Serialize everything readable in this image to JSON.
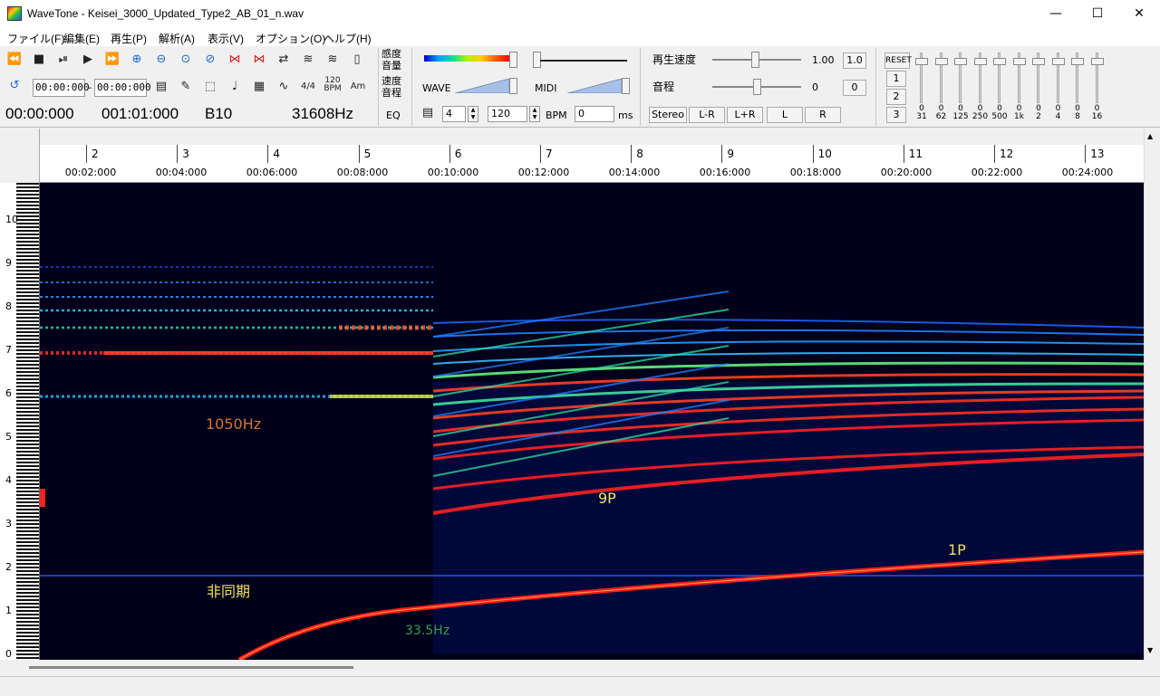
{
  "window": {
    "title": "WaveTone - Keisei_3000_Updated_Type2_AB_01_n.wav",
    "controls": {
      "minimize": "—",
      "maximize": "☐",
      "close": "✕"
    }
  },
  "menu": [
    "ファイル(F)",
    "編集(E)",
    "再生(P)",
    "解析(A)",
    "表示(V)",
    "オプション(O)",
    "ヘルプ(H)"
  ],
  "toolbar": {
    "transport_icons": [
      "rewind-icon",
      "stop-icon",
      "pause-play-icon",
      "play-icon",
      "fast-forward-icon",
      "zoom-in-icon",
      "zoom-out-icon",
      "zoom-fit-icon",
      "zoom-reset-icon",
      "expand-h-icon",
      "shrink-h-icon",
      "arrows-icon",
      "waveform-icon",
      "waveform2-icon",
      "book-icon"
    ],
    "range_start": "00:00:000",
    "range_end": "00:00:000",
    "range_sep": "–",
    "labels": {
      "sensitivity_top": "感度",
      "sensitivity_bottom": "音量",
      "speed_top": "速度",
      "speed_bottom": "音程",
      "wave": "WAVE",
      "midi": "MIDI",
      "eq": "EQ",
      "bpm": "BPM",
      "ms": "ms",
      "time_sig": "4/4",
      "bpm_icon_top": "120",
      "bpm_icon_bottom": "BPM",
      "chord": "Am"
    },
    "readouts": {
      "position": "00:00:000",
      "measure": "001:01:000",
      "note": "B10",
      "frequency": "31608Hz"
    },
    "beat_value": "4",
    "bpm_value": "120",
    "ms_value": "0",
    "playback_speed_label": "再生速度",
    "playback_speed_value": "1.00",
    "playback_speed_reset": "1.0",
    "pitch_label": "音程",
    "pitch_value": "0",
    "pitch_reset": "0",
    "channel_buttons": [
      "Stereo",
      "L-R",
      "L+R",
      "L",
      "R"
    ],
    "eq_reset": "RESET",
    "eq_presets": [
      "1",
      "2",
      "3"
    ],
    "eq_bands": [
      {
        "freq": "31",
        "value": "0"
      },
      {
        "freq": "62",
        "value": "0"
      },
      {
        "freq": "125",
        "value": "0"
      },
      {
        "freq": "250",
        "value": "0"
      },
      {
        "freq": "500",
        "value": "0"
      },
      {
        "freq": "1k",
        "value": "0"
      },
      {
        "freq": "2",
        "value": "0"
      },
      {
        "freq": "4",
        "value": "0"
      },
      {
        "freq": "8",
        "value": "0"
      },
      {
        "freq": "16",
        "value": "0"
      }
    ]
  },
  "timeline": {
    "measures": [
      "2",
      "3",
      "4",
      "5",
      "6",
      "7",
      "8",
      "9",
      "10",
      "11",
      "12",
      "13"
    ],
    "times": [
      "00:02:000",
      "00:04:000",
      "00:06:000",
      "00:08:000",
      "00:10:000",
      "00:12:000",
      "00:14:000",
      "00:16:000",
      "00:18:000",
      "00:20:000",
      "00:22:000",
      "00:24:000"
    ]
  },
  "keyboard": {
    "octaves": [
      "10",
      "9",
      "8",
      "7",
      "6",
      "5",
      "4",
      "3",
      "2",
      "1",
      "0"
    ]
  },
  "annotations": {
    "freq_1050": "1050Hz",
    "nine_p": "9P",
    "one_p": "1P",
    "async": "非同期",
    "freq_33": "33.5Hz"
  },
  "colors": {
    "spectro_bg": "#00001a",
    "harmonic_hot": "#ff1a1a",
    "annotation_orange": "#d07830",
    "annotation_yellow": "#f0e060",
    "annotation_green": "#30a050"
  }
}
